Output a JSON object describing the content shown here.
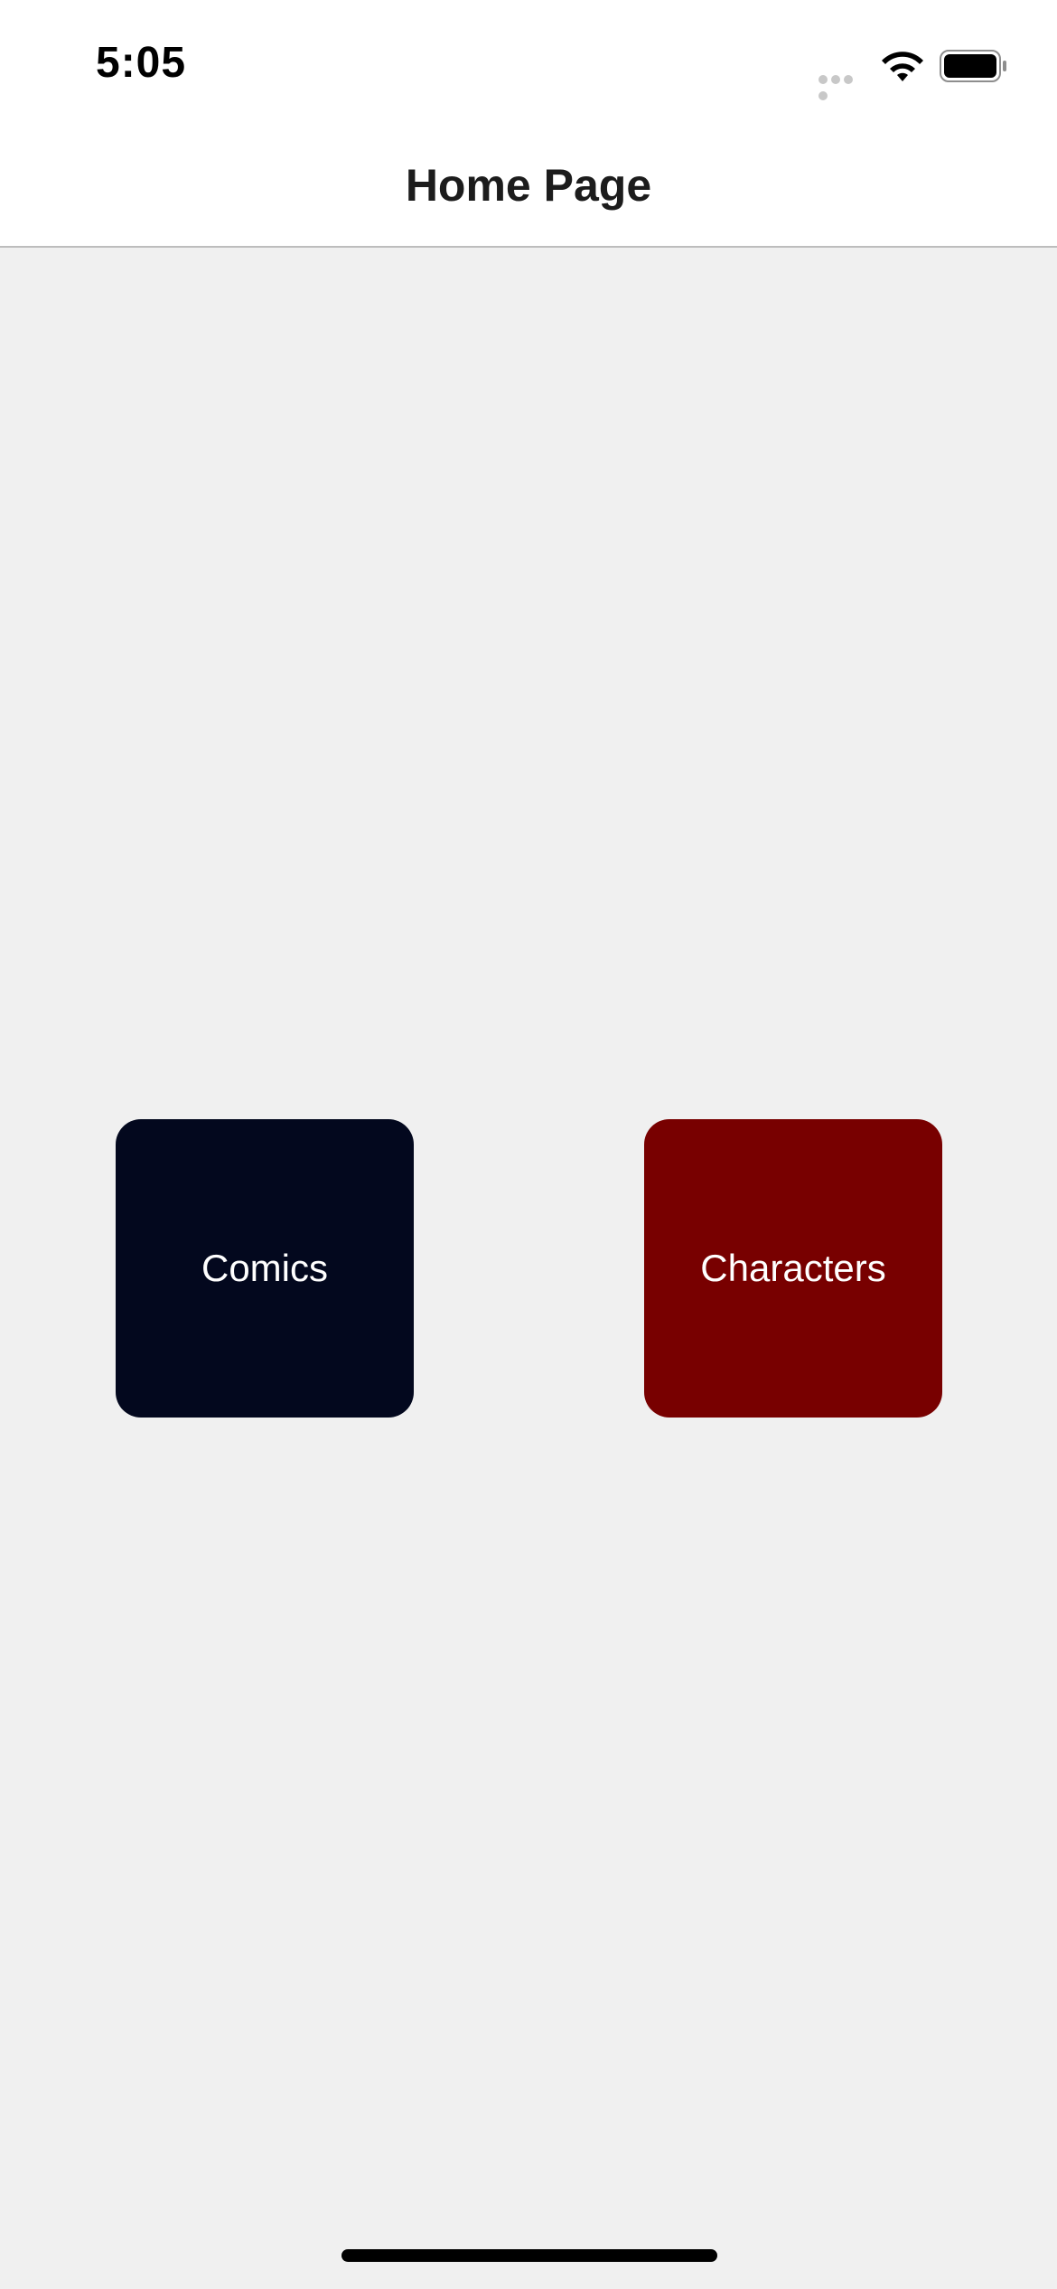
{
  "status_bar": {
    "time": "5:05",
    "icons": [
      "signal-dots-icon",
      "wifi-icon",
      "battery-icon"
    ]
  },
  "nav": {
    "title": "Home Page"
  },
  "tiles": [
    {
      "label": "Comics",
      "color": "#03081e"
    },
    {
      "label": "Characters",
      "color": "#780000"
    }
  ],
  "colors": {
    "background": "#f0f0f0",
    "bar_background": "#ffffff",
    "tile_text": "#ffffff"
  }
}
